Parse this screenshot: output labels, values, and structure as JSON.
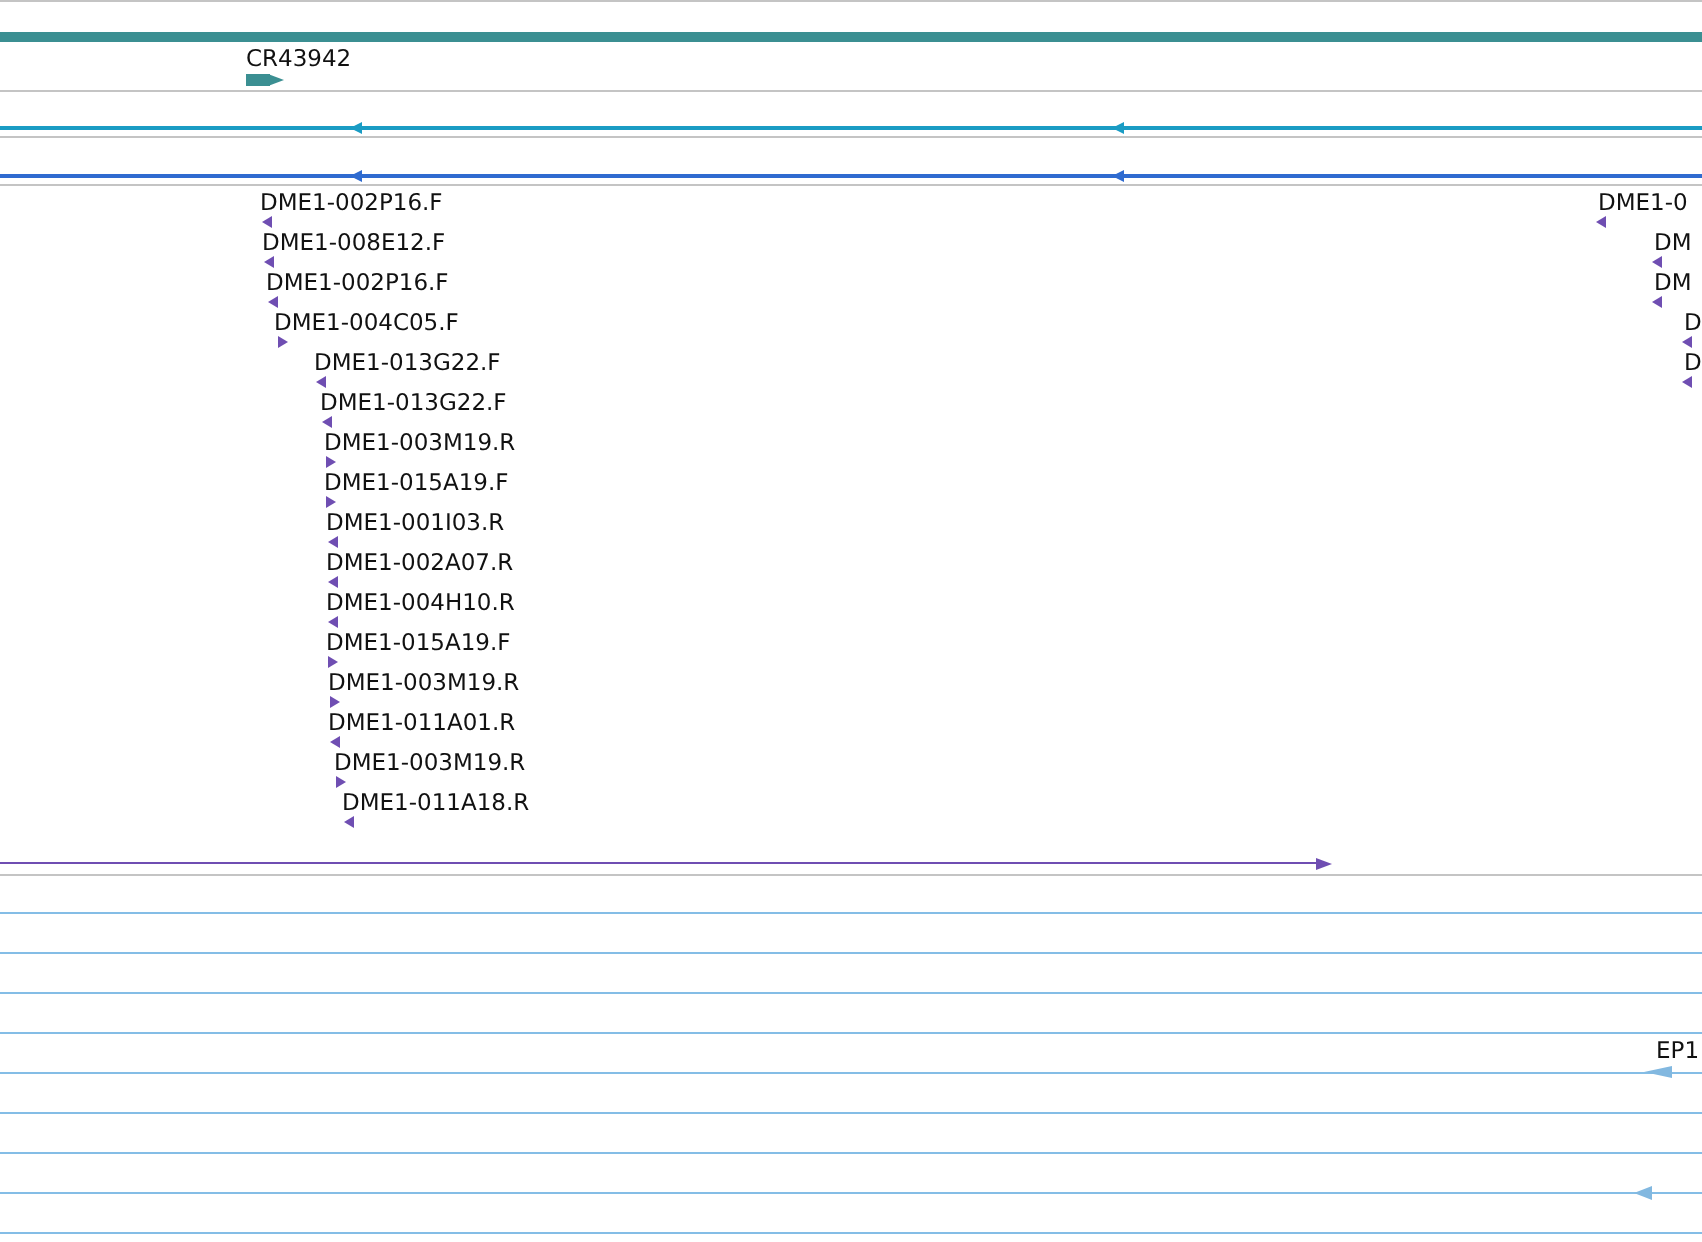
{
  "tracks": [
    {
      "kind": "gene",
      "features": [
        {
          "label": "CR43942",
          "reverse": false
        }
      ]
    },
    {
      "kind": "transcript",
      "color": "#1a9cc4",
      "features": [
        {
          "reverse": true
        },
        {
          "reverse": true
        }
      ]
    },
    {
      "kind": "transcript",
      "color": "#2f6bd0",
      "features": [
        {
          "reverse": true
        },
        {
          "reverse": true
        }
      ]
    },
    {
      "kind": "ests",
      "features": [
        {
          "label": "DME1-002P16.F",
          "reverse": true
        },
        {
          "label": "DME1-008E12.F",
          "reverse": true
        },
        {
          "label": "DME1-002P16.F",
          "reverse": true
        },
        {
          "label": "DME1-004C05.F",
          "reverse": false
        },
        {
          "label": "DME1-013G22.F",
          "reverse": true
        },
        {
          "label": "DME1-013G22.F",
          "reverse": true
        },
        {
          "label": "DME1-003M19.R",
          "reverse": false
        },
        {
          "label": "DME1-015A19.F",
          "reverse": false
        },
        {
          "label": "DME1-001I03.R",
          "reverse": true
        },
        {
          "label": "DME1-002A07.R",
          "reverse": true
        },
        {
          "label": "DME1-004H10.R",
          "reverse": true
        },
        {
          "label": "DME1-015A19.F",
          "reverse": false
        },
        {
          "label": "DME1-003M19.R",
          "reverse": false
        },
        {
          "label": "DME1-011A01.R",
          "reverse": true
        },
        {
          "label": "DME1-003M19.R",
          "reverse": false
        },
        {
          "label": "DME1-011A18.R",
          "reverse": true
        },
        {
          "label": "DME1-0",
          "reverse": true
        },
        {
          "label": "DM",
          "reverse": true
        },
        {
          "label": "DM",
          "reverse": true
        },
        {
          "label": "D",
          "reverse": true
        },
        {
          "label": "D",
          "reverse": true
        }
      ]
    },
    {
      "kind": "span",
      "features": [
        {
          "reverse": false
        }
      ]
    },
    {
      "kind": "insertions",
      "features": [
        {
          "label": "EP1",
          "reverse": true
        },
        {
          "reverse": true
        }
      ]
    }
  ]
}
